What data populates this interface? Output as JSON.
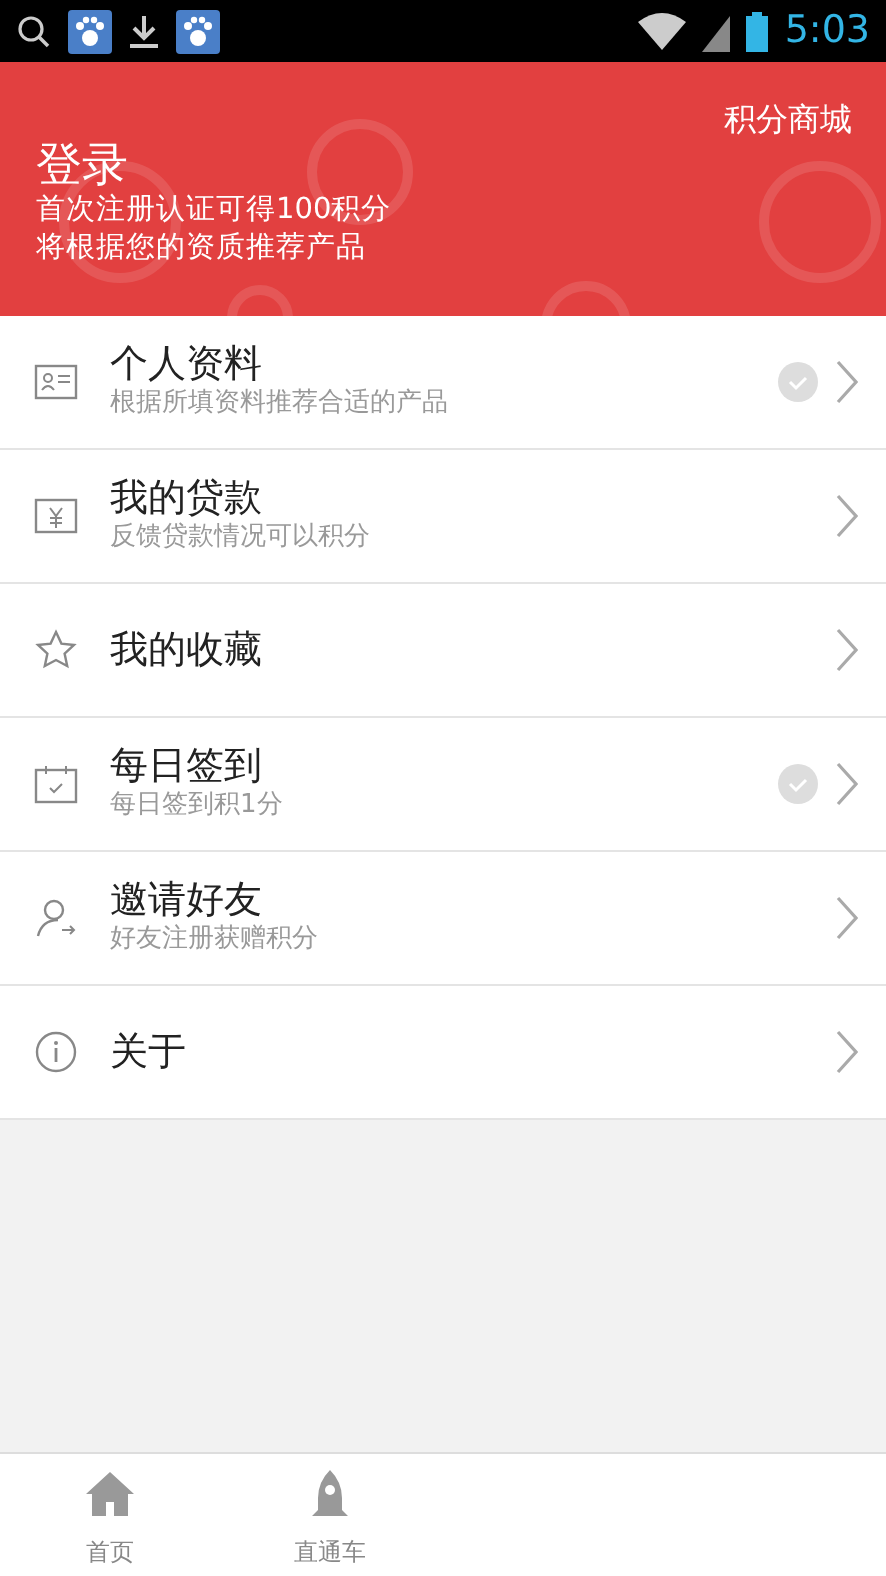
{
  "status_bar": {
    "time": "5:03"
  },
  "header": {
    "title": "登录",
    "subtitle_lines": [
      "首次注册认证可得100积分",
      "将根据您的资质推荐产品"
    ],
    "action": "积分商城"
  },
  "menu": [
    {
      "kind": "profile",
      "title": "个人资料",
      "subtitle": "根据所填资料推荐合适的产品",
      "checked": true
    },
    {
      "kind": "loan",
      "title": "我的贷款",
      "subtitle": "反馈贷款情况可以积分",
      "checked": false
    },
    {
      "kind": "favorite",
      "title": "我的收藏",
      "checked": false
    },
    {
      "kind": "checkin",
      "title": "每日签到",
      "subtitle": "每日签到积1分",
      "checked": true
    },
    {
      "kind": "invite",
      "title": "邀请好友",
      "subtitle": "好友注册获赠积分",
      "checked": false
    },
    {
      "kind": "about",
      "title": "关于",
      "checked": false
    }
  ],
  "tab_bar": [
    {
      "kind": "home",
      "label": "首页"
    },
    {
      "kind": "rocket",
      "label": "直通车"
    }
  ]
}
